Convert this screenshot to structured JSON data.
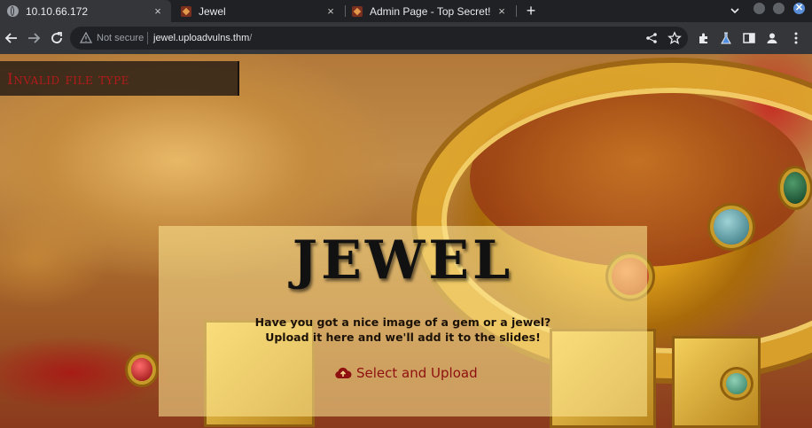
{
  "browser": {
    "tabs": [
      {
        "title": "10.10.66.172",
        "icon": "globe-icon",
        "active": true
      },
      {
        "title": "Jewel",
        "icon": "jewel-favicon",
        "active": false
      },
      {
        "title": "Admin Page - Top Secret!",
        "icon": "jewel-favicon",
        "active": false
      }
    ],
    "close_glyph": "×",
    "new_tab_glyph": "+",
    "address": {
      "security_label": "Not secure",
      "host": "jewel.uploadvulns.thm",
      "path": "/"
    }
  },
  "page": {
    "toast_message": "Invalid file type",
    "title": "JEWEL",
    "subtitle_line1": "Have you got a nice image of a gem or a jewel?",
    "subtitle_line2": "Upload it here and we'll add it to the slides!",
    "upload_label": "Select and Upload",
    "colors": {
      "accent_red": "#8e1010",
      "toast_text": "#b31b1b"
    }
  }
}
